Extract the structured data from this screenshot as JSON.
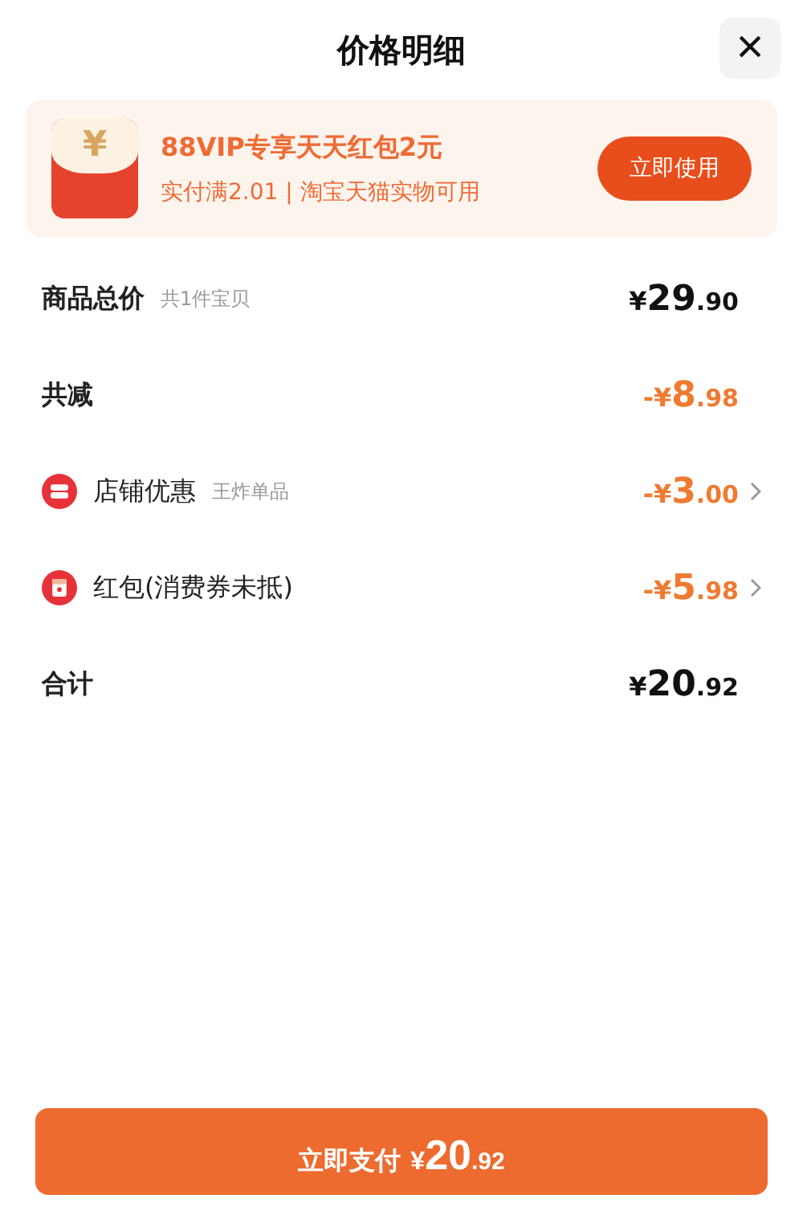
{
  "header": {
    "title": "价格明细",
    "close": "×"
  },
  "promo": {
    "title": "88VIP专享天天红包2元",
    "subtitle": "实付满2.01 | 淘宝天猫实物可用",
    "button": "立即使用",
    "icon": "¥"
  },
  "rows": [
    {
      "kind": "heading",
      "label": "商品总价",
      "note": "共1件宝贝",
      "price": {
        "prefix": "¥",
        "int": "29",
        "dec": ".90"
      },
      "discount": false,
      "chevron": false
    },
    {
      "kind": "heading",
      "label": "共减",
      "price": {
        "prefix": "-¥",
        "int": "8",
        "dec": ".98"
      },
      "discount": true,
      "chevron": false
    },
    {
      "kind": "shop",
      "label": "店铺优惠",
      "note": "王炸单品",
      "price": {
        "prefix": "-¥",
        "int": "3",
        "dec": ".00"
      },
      "discount": true,
      "chevron": true
    },
    {
      "kind": "redpacket",
      "label": "红包(消费券未抵)",
      "price": {
        "prefix": "-¥",
        "int": "5",
        "dec": ".98"
      },
      "discount": true,
      "chevron": true
    },
    {
      "kind": "heading",
      "label": "合计",
      "price": {
        "prefix": "¥",
        "int": "20",
        "dec": ".92"
      },
      "discount": false,
      "chevron": false
    }
  ],
  "pay_button": {
    "label": "立即支付",
    "price": {
      "prefix": "¥",
      "int": "20",
      "dec": ".92"
    }
  }
}
